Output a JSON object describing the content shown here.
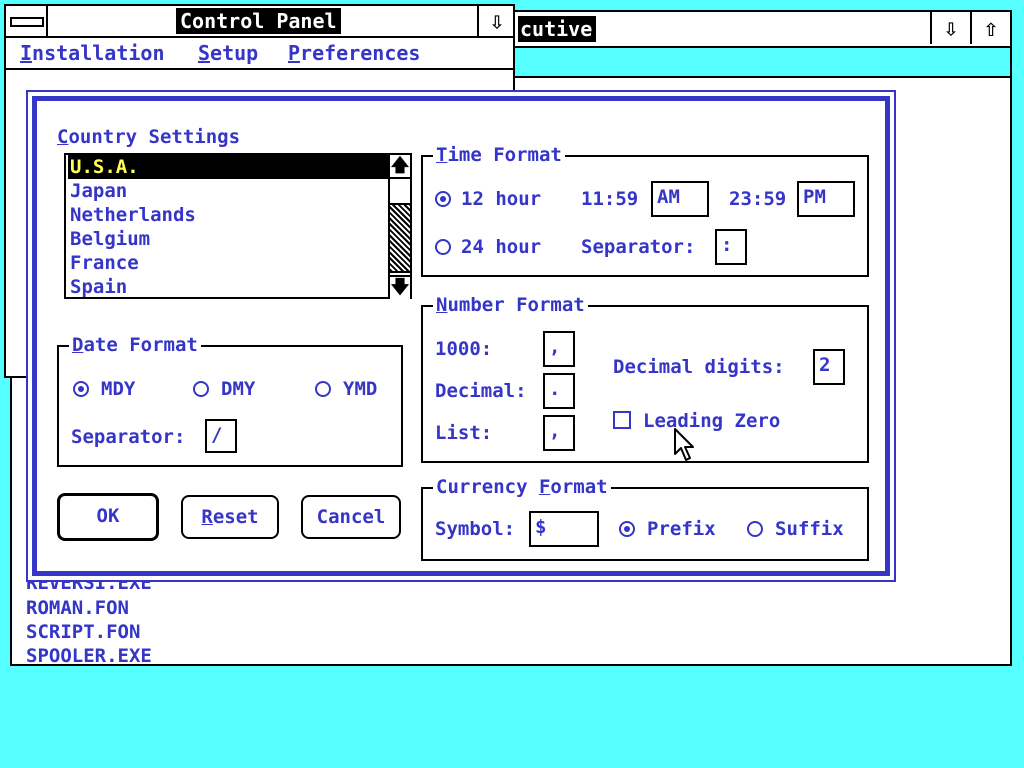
{
  "executive": {
    "title": "cutive",
    "minimize_glyph": "⇩",
    "maximize_glyph": "⇧",
    "files": [
      "REVERSI.EXE",
      "ROMAN.FON",
      "SCRIPT.FON",
      "SPOOLER.EXE"
    ]
  },
  "control_panel": {
    "title": "Control Panel",
    "minimize_glyph": "⇩",
    "menu": [
      {
        "label": "Installation",
        "accel": "I",
        "rest": "nstallation"
      },
      {
        "label": "Setup",
        "accel": "S",
        "rest": "etup"
      },
      {
        "label": "Preferences",
        "accel": "P",
        "rest": "references"
      }
    ]
  },
  "dialog": {
    "country_settings": {
      "accel": "C",
      "rest": "ountry Settings"
    },
    "countries": [
      "U.S.A.",
      "Japan",
      "Netherlands",
      "Belgium",
      "France",
      "Spain"
    ],
    "selected_country": "U.S.A.",
    "scroll_up_glyph": "🡅",
    "scroll_down_glyph": "🡇",
    "date_format": {
      "label_accel": "D",
      "label_rest": "ate Format",
      "options": [
        "MDY",
        "DMY",
        "YMD"
      ],
      "selected": "MDY",
      "separator_label": "Separator:",
      "separator_value": "/"
    },
    "time_format": {
      "label_accel": "T",
      "label_rest": "ime Format",
      "option_12": "12 hour",
      "option_24": "24 hour",
      "selected": "12 hour",
      "time_12": "11:59",
      "am_value": "AM",
      "time_24": "23:59",
      "pm_value": "PM",
      "separator_label": "Separator:",
      "separator_value": ":"
    },
    "number_format": {
      "label_accel": "N",
      "label_rest": "umber Format",
      "thousands_label": "1000:",
      "thousands_value": ",",
      "decimal_label": "Decimal:",
      "decimal_value": ".",
      "list_label": "List:",
      "list_value": ",",
      "decimal_digits_label": "Decimal digits:",
      "decimal_digits_value": "2",
      "leading_zero_label": "Leading Zero",
      "leading_zero_checked": false
    },
    "currency_format": {
      "label_pre": "Currency ",
      "label_accel": "F",
      "label_rest": "ormat",
      "symbol_label": "Symbol:",
      "symbol_value": "$",
      "prefix_label": "Prefix",
      "suffix_label": "Suffix",
      "selected": "Prefix"
    },
    "buttons": {
      "ok": "OK",
      "reset_accel": "R",
      "reset_rest": "eset",
      "cancel": "Cancel"
    }
  },
  "colors": {
    "desktop": "#55ffff",
    "text": "#3535c8",
    "selection_bg": "#000000",
    "selection_fg": "#ffff55"
  }
}
